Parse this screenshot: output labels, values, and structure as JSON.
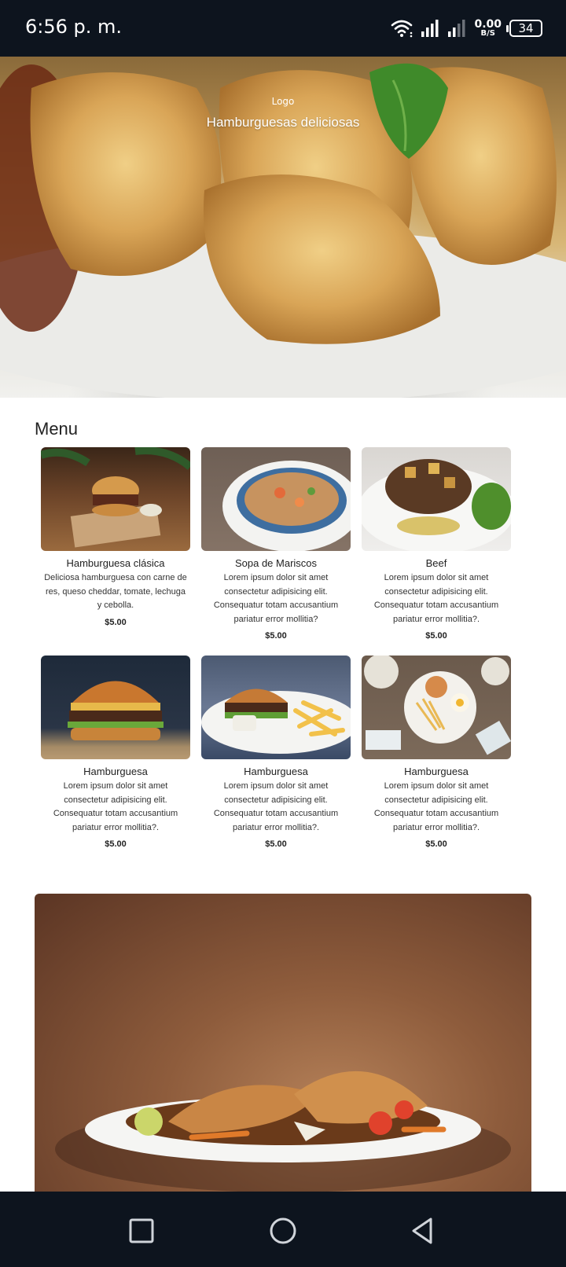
{
  "status_bar": {
    "time": "6:56 p. m.",
    "net_speed_value": "0.00",
    "net_speed_unit": "B/S",
    "battery": "34"
  },
  "hero": {
    "logo_alt": "Logo",
    "title": "Hamburguesas deliciosas"
  },
  "menu": {
    "title": "Menu",
    "items": [
      {
        "name": "Hamburguesa clásica",
        "description": "Deliciosa hamburguesa con carne de res, queso cheddar, tomate, lechuga y cebolla.",
        "price": "$5.00"
      },
      {
        "name": "Sopa de Mariscos",
        "description": "Lorem ipsum dolor sit amet consectetur adipisicing elit. Consequatur totam accusantium pariatur error mollitia?",
        "price": "$5.00"
      },
      {
        "name": "Beef",
        "description": "Lorem ipsum dolor sit amet consectetur adipisicing elit. Consequatur totam accusantium pariatur error mollitia?.",
        "price": "$5.00"
      },
      {
        "name": "Hamburguesa",
        "description": "Lorem ipsum dolor sit amet consectetur adipisicing elit. Consequatur totam accusantium pariatur error mollitia?.",
        "price": "$5.00"
      },
      {
        "name": "Hamburguesa",
        "description": "Lorem ipsum dolor sit amet consectetur adipisicing elit. Consequatur totam accusantium pariatur error mollitia?.",
        "price": "$5.00"
      },
      {
        "name": "Hamburguesa",
        "description": "Lorem ipsum dolor sit amet consectetur adipisicing elit. Consequatur totam accusantium pariatur error mollitia?.",
        "price": "$5.00"
      }
    ]
  },
  "colors": {
    "system_bar": "#0d141e",
    "text_primary": "#222222"
  }
}
